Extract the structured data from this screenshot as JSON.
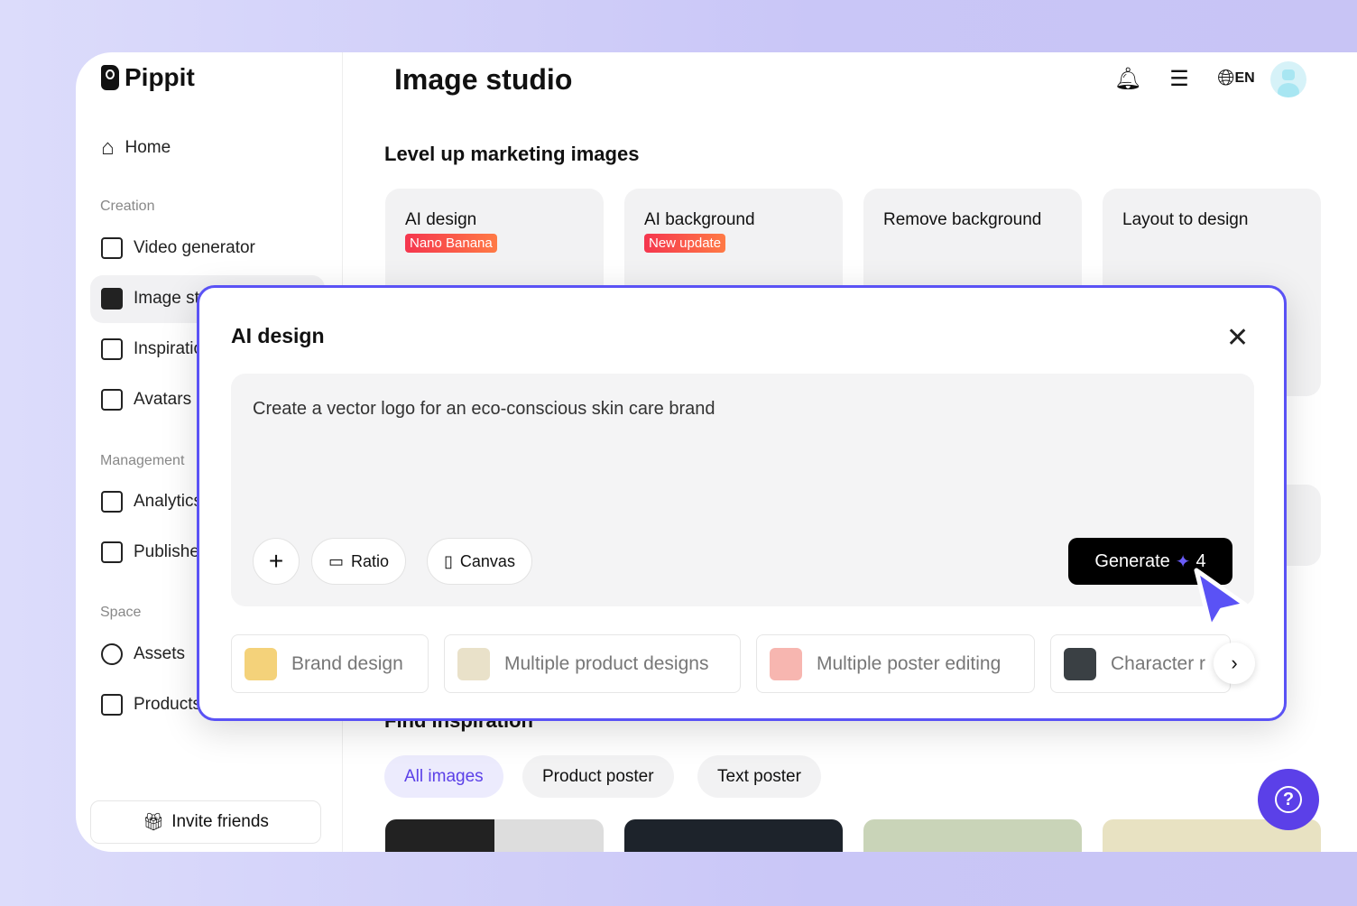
{
  "app": {
    "name": "Pippit",
    "page_title": "Image studio"
  },
  "sidebar": {
    "home": "Home",
    "sections": {
      "creation": "Creation",
      "management": "Management",
      "space": "Space"
    },
    "items": [
      {
        "label": "Video generator",
        "icon": "video-sparkle-icon"
      },
      {
        "label": "Image studio",
        "icon": "image-sparkle-icon",
        "active": true
      },
      {
        "label": "Inspiration",
        "icon": "inspiration-icon"
      },
      {
        "label": "Avatars",
        "icon": "avatar-icon"
      },
      {
        "label": "Analytics",
        "icon": "analytics-icon"
      },
      {
        "label": "Publisher",
        "icon": "calendar-icon"
      },
      {
        "label": "Assets",
        "icon": "cloud-icon"
      },
      {
        "label": "Products",
        "icon": "product-icon"
      }
    ],
    "invite": "Invite friends"
  },
  "header": {
    "language": "EN",
    "icons": [
      "bell-icon",
      "stack-icon",
      "globe-icon",
      "avatar"
    ]
  },
  "main": {
    "section_title": "Level up marketing images",
    "cards": [
      {
        "title": "AI design",
        "badge": "Nano Banana"
      },
      {
        "title": "AI background",
        "badge": "New update"
      },
      {
        "title": "Remove background"
      },
      {
        "title": "Layout to design"
      }
    ],
    "inspiration_title": "Find inspiration",
    "filters": [
      {
        "label": "All images",
        "active": true
      },
      {
        "label": "Product poster"
      },
      {
        "label": "Text poster"
      }
    ]
  },
  "modal": {
    "title": "AI design",
    "prompt": "Create a vector logo for an eco-conscious skin care brand",
    "ratio": "Ratio",
    "canvas": "Canvas",
    "generate": "Generate",
    "credits": "4",
    "suggestions": [
      "Brand design",
      "Multiple product designs",
      "Multiple poster editing",
      "Character r"
    ]
  },
  "colors": {
    "accent": "#5a52f5",
    "badge": "#f5364e",
    "active_filter": "#5b40e8"
  }
}
